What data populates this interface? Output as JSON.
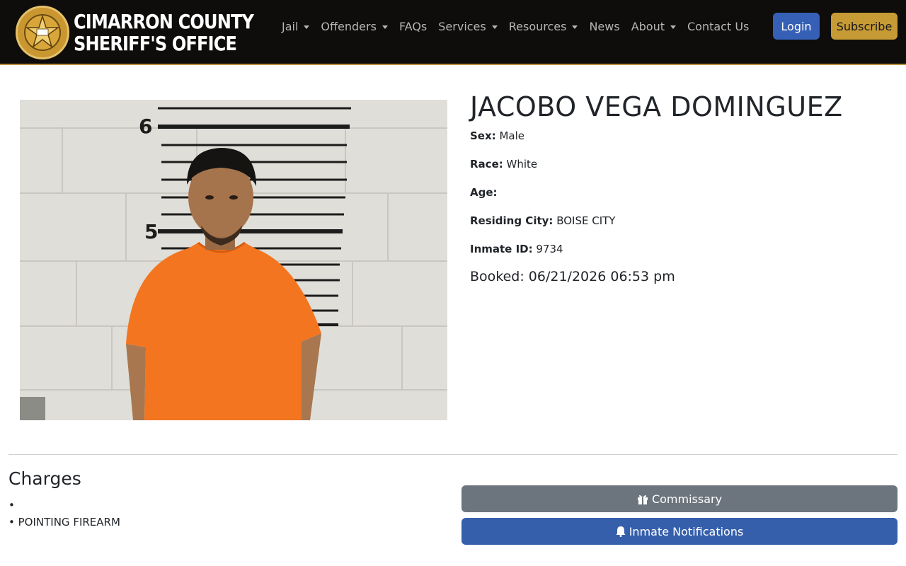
{
  "brand": {
    "line1": "CIMARRON COUNTY",
    "line2": "SHERIFF'S OFFICE",
    "seal_text_top": "CIMARRON COUNTY",
    "seal_text_bottom": "SHERIFF'S OFFICE"
  },
  "nav": [
    {
      "label": "Jail",
      "dropdown": true
    },
    {
      "label": "Offenders",
      "dropdown": true
    },
    {
      "label": "FAQs",
      "dropdown": false
    },
    {
      "label": "Services",
      "dropdown": true
    },
    {
      "label": "Resources",
      "dropdown": true
    },
    {
      "label": "News",
      "dropdown": false
    },
    {
      "label": "About",
      "dropdown": true
    },
    {
      "label": "Contact Us",
      "dropdown": false
    }
  ],
  "header_buttons": {
    "login": "Login",
    "subscribe": "Subscribe"
  },
  "inmate": {
    "name": "JACOBO VEGA DOMINGUEZ",
    "fields": [
      {
        "label": "Sex:",
        "value": "Male"
      },
      {
        "label": "Race:",
        "value": "White"
      },
      {
        "label": "Age:",
        "value": ""
      },
      {
        "label": "Residing City:",
        "value": "BOISE CITY"
      },
      {
        "label": "Inmate ID:",
        "value": "9734"
      }
    ],
    "booked": "Booked: 06/21/2026 06:53 pm"
  },
  "mugshot": {
    "height_marks": [
      "6",
      "5"
    ]
  },
  "charges": {
    "title": "Charges",
    "items": [
      "",
      "POINTING FIREARM"
    ]
  },
  "actions": {
    "commissary": "Commissary",
    "notifications": "Inmate Notifications"
  },
  "colors": {
    "navbar": "#0e0d0c",
    "login": "#3660b5",
    "subscribe": "#c69a35",
    "commissary": "#6c757d",
    "notifications": "#365fab",
    "accent_border": "#b8913a"
  }
}
